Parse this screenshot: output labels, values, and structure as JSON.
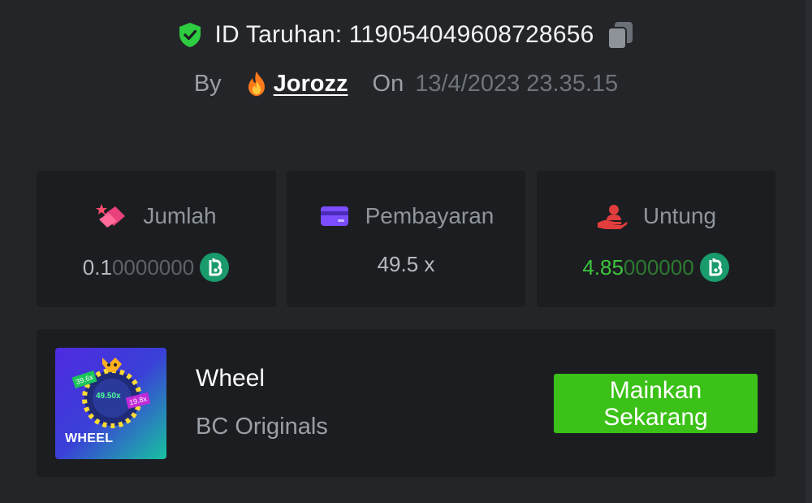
{
  "bet": {
    "id_label": "ID Taruhan: 119054049608728656",
    "by_label": "By",
    "username": "Jorozz",
    "on_label": "On",
    "date": "13/4/2023 23.35.15"
  },
  "stats": {
    "amount": {
      "label": "Jumlah",
      "value_strong": "0.1",
      "value_dim": "0000000",
      "icon": "coin-stack-icon"
    },
    "payout": {
      "label": "Pembayaran",
      "value": "49.5 x",
      "icon": "card-icon"
    },
    "profit": {
      "label": "Untung",
      "value_strong": "4.85",
      "value_dim": "000000",
      "icon": "hand-user-icon"
    },
    "currency_icon": "bc-coin-icon"
  },
  "game": {
    "title": "Wheel",
    "provider": "BC Originals",
    "thumbnail_label": "WHEEL",
    "thumbnail_values": [
      "39.6x",
      "49.50x",
      "19.8x"
    ],
    "play_label": "Mainkan\nSekarang"
  },
  "colors": {
    "background": "#242529",
    "card": "#1c1d21",
    "accent_green": "#3bc117",
    "profit_green": "#3dc63c",
    "verified_green": "#2ecc40",
    "pink": "#e8407a",
    "purple": "#7b4dff",
    "red": "#e23d3d"
  }
}
